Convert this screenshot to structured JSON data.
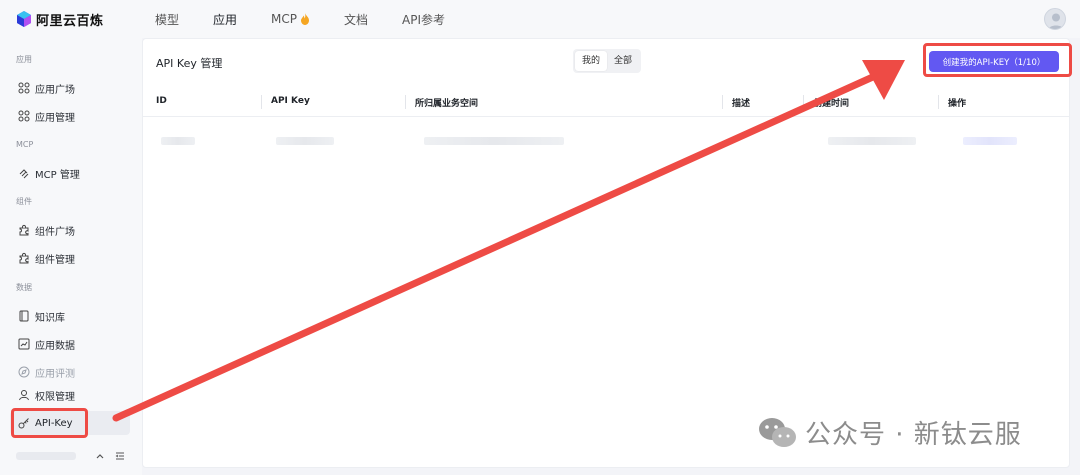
{
  "brand": {
    "name": "阿里云百炼"
  },
  "nav": {
    "items": [
      {
        "label": "模型"
      },
      {
        "label": "应用"
      },
      {
        "label": "MCP"
      },
      {
        "label": "文档"
      },
      {
        "label": "API参考"
      }
    ]
  },
  "sidebar": {
    "group_app": "应用",
    "item_app_plaza": "应用广场",
    "item_app_manage": "应用管理",
    "group_mcp": "MCP",
    "item_mcp_manage": "MCP 管理",
    "group_component": "组件",
    "item_component_plaza": "组件广场",
    "item_component_manage": "组件管理",
    "group_data": "数据",
    "item_knowledge": "知识库",
    "item_app_data": "应用数据",
    "item_app_eval": "应用评测",
    "item_permission": "权限管理",
    "item_api_key": "API-Key"
  },
  "panel": {
    "title": "API Key 管理",
    "segment": {
      "mine": "我的",
      "all": "全部"
    },
    "create_button": "创建我的API-KEY（1/10）",
    "columns": {
      "id": "ID",
      "api_key": "API Key",
      "workspace": "所归属业务空间",
      "desc": "描述",
      "created": "创建时间",
      "actions": "操作"
    }
  },
  "watermark": {
    "text": "公众号 · 新钛云服"
  },
  "colors": {
    "accent": "#6258f2",
    "annotation_red": "#ee4b45"
  }
}
